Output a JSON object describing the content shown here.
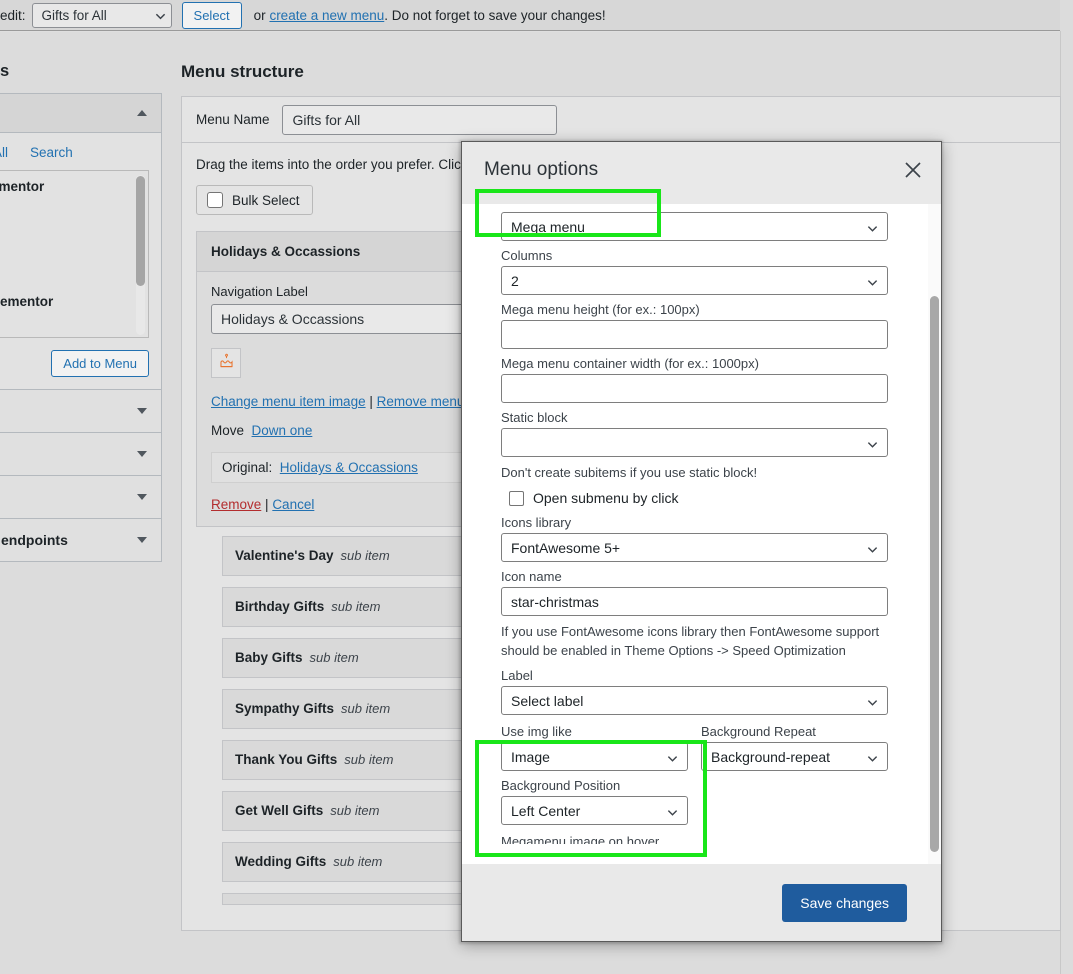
{
  "topbar": {
    "lead": "edit:",
    "menu_select_value": "Gifts for All",
    "select_button": "Select",
    "or_text": "or ",
    "create_link": "create a new menu",
    "tail_text": ". Do not forget to save your changes!"
  },
  "left_panel": {
    "title": "s",
    "view_all": "View All",
    "search": "Search",
    "list_items": [
      "- Elementor",
      "",
      "",
      "— Elementor"
    ],
    "add_to_menu": "Add to Menu",
    "accordion_labels": [
      "",
      "",
      "",
      "endpoints"
    ]
  },
  "menu_structure": {
    "heading": "Menu structure",
    "menu_name_label": "Menu Name",
    "menu_name_value": "Gifts for All",
    "drag_hint": "Drag the items into the order you prefer. Clic",
    "bulk_select": "Bulk Select",
    "item": {
      "title": "Holidays & Occassions",
      "type": "8Them",
      "nav_label_field": "Navigation Label",
      "nav_label_value": "Holidays & Occassions",
      "image_icon": "cake-icon",
      "change_image_link": "Change menu item image",
      "separator": " | ",
      "remove_image_link": "Remove menu i",
      "move_label": "Move",
      "move_link": "Down one",
      "original_label": "Original:",
      "original_link": "Holidays & Occassions",
      "remove_link": "Remove",
      "cancel_link": "Cancel"
    },
    "sub_items": [
      {
        "name": "Valentine's Day",
        "tag": "sub item",
        "type": "8"
      },
      {
        "name": "Birthday Gifts",
        "tag": "sub item",
        "type": "8"
      },
      {
        "name": "Baby Gifts",
        "tag": "sub item",
        "type": "8"
      },
      {
        "name": "Sympathy Gifts",
        "tag": "sub item",
        "type": "8"
      },
      {
        "name": "Thank You Gifts",
        "tag": "sub item",
        "type": "8"
      },
      {
        "name": "Get Well Gifts",
        "tag": "sub item",
        "type": "8"
      },
      {
        "name": "Wedding Gifts",
        "tag": "sub item",
        "type": "8"
      }
    ]
  },
  "modal": {
    "title": "Menu options",
    "close_icon": "close-icon",
    "fields": {
      "menu_type_value": "Mega menu",
      "columns_label": "Columns",
      "columns_value": "2",
      "height_label": "Mega menu height (for ex.: 100px)",
      "height_value": "",
      "width_label": "Mega menu container width (for ex.: 1000px)",
      "width_value": "",
      "static_block_label": "Static block",
      "static_block_value": "",
      "static_block_hint": "Don't create subitems if you use static block!",
      "open_submenu_label": "Open submenu by click",
      "icons_library_label": "Icons library",
      "icons_library_value": "FontAwesome 5+",
      "icon_name_label": "Icon name",
      "icon_name_value": "star-christmas",
      "icon_hint": "If you use FontAwesome icons library then FontAwesome support should be enabled in Theme Options -> Speed Optimization",
      "label_label": "Label",
      "label_value": "Select label",
      "use_img_like_label": "Use img like",
      "use_img_like_value": "Image",
      "bg_repeat_label": "Background Repeat",
      "bg_repeat_value": "Background-repeat",
      "bg_position_label": "Background Position",
      "bg_position_value": "Left Center",
      "cutoff_label": "Megamenu image on hover"
    },
    "save_button": "Save changes"
  },
  "highlights": {
    "color": "#19e619",
    "boxes": [
      "mega-menu-select",
      "image-options-group"
    ]
  }
}
